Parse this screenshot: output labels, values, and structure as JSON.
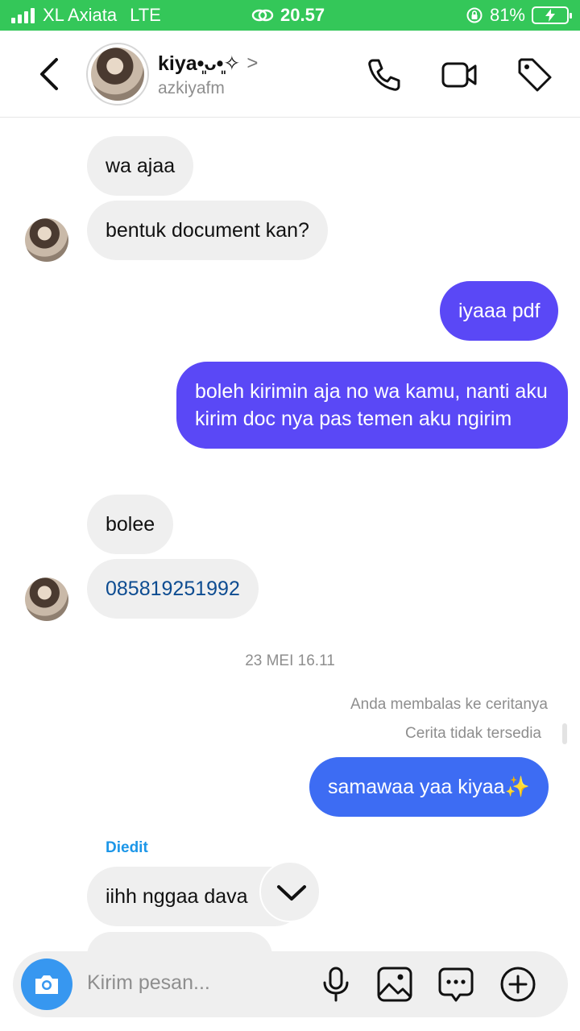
{
  "status": {
    "carrier": "XL Axiata",
    "network": "LTE",
    "time": "20.57",
    "battery": "81%"
  },
  "header": {
    "name": "kiya•͈ᴗ•͈✧",
    "handle": "azkiyafm",
    "icons": [
      "back-chevron-icon",
      "phone-icon",
      "video-icon",
      "tag-icon"
    ]
  },
  "messages": [
    {
      "side": "in",
      "text": "wa ajaa"
    },
    {
      "side": "in",
      "text": "bentuk document kan?"
    },
    {
      "side": "out",
      "text": "iyaaa pdf"
    },
    {
      "side": "out",
      "text": "boleh kirimin aja no wa kamu, nanti aku kirim doc nya pas temen aku ngirim"
    },
    {
      "side": "in",
      "text": "bolee"
    },
    {
      "side": "in",
      "text": "085819251992"
    },
    {
      "side": "out",
      "text": "samawaa yaa kiyaa✨"
    },
    {
      "side": "in",
      "text": "iihh nggaa dava"
    }
  ],
  "date_separator": "23 MEI 16.11",
  "story_reply": {
    "line1": "Anda membalas ke ceritanya",
    "line2": "Cerita tidak tersedia"
  },
  "edited_label": "Diedit",
  "composer": {
    "placeholder": "Kirim pesan...",
    "icons": [
      "camera-icon",
      "microphone-icon",
      "gallery-icon",
      "sticker-icon",
      "plus-icon"
    ]
  },
  "colors": {
    "status_bar": "#34c759",
    "outgoing_purple": "#5a48f6",
    "outgoing_blue": "#3d6cf3",
    "incoming": "#efefef",
    "edited": "#1c96e8",
    "camera_button": "#3797f0"
  }
}
